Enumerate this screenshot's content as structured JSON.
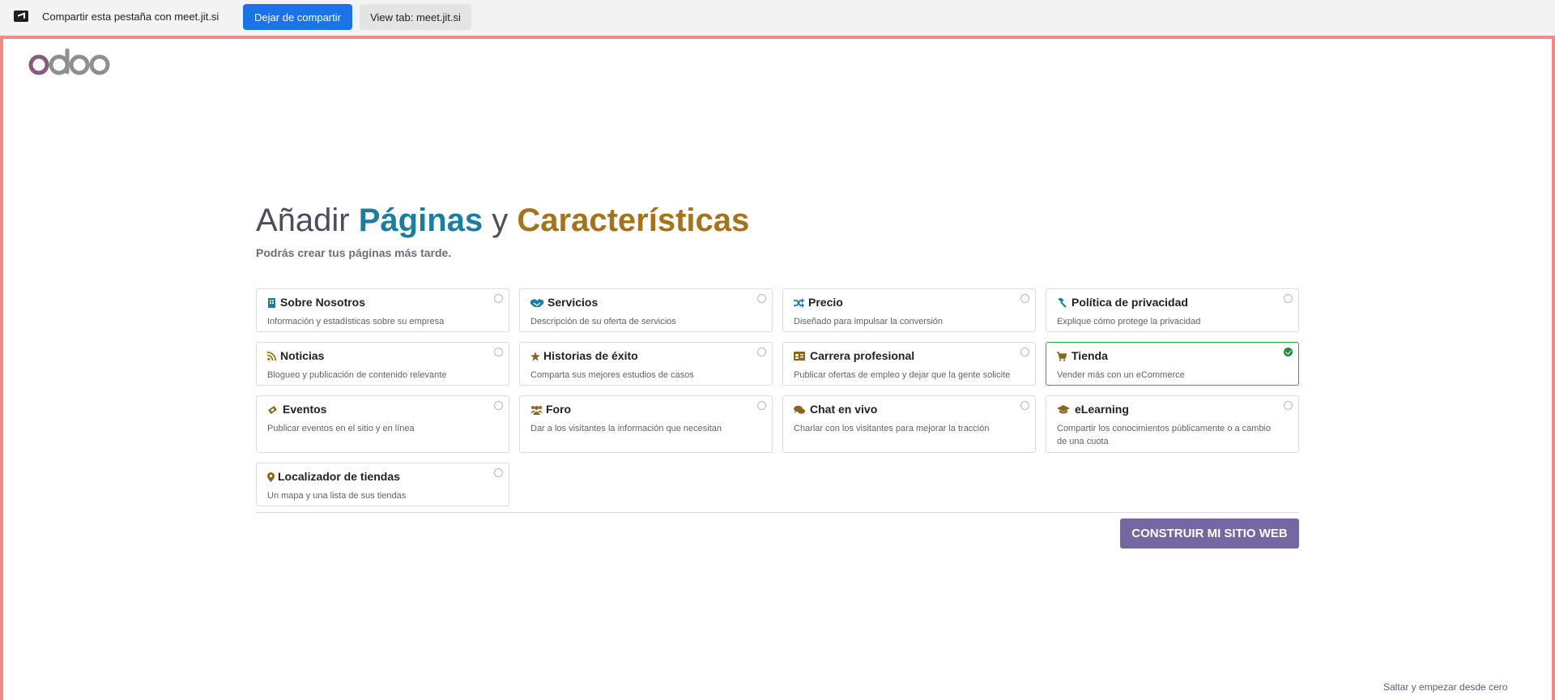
{
  "share_bar": {
    "text": "Compartir esta pestaña con meet.jit.si",
    "stop_label": "Dejar de compartir",
    "view_label": "View tab: meet.jit.si"
  },
  "brand": {
    "logo_text": "odoo",
    "accent": "#7567a1"
  },
  "header": {
    "title_prefix": "Añadir",
    "title_pages": "Páginas",
    "title_and": "y",
    "title_features": "Características",
    "subtitle": "Podrás crear tus páginas más tarde."
  },
  "cards": [
    {
      "title": "Sobre Nosotros",
      "desc": "Información y estadísticas sobre su empresa",
      "icon": "building-icon",
      "selected": false
    },
    {
      "title": "Servicios",
      "desc": "Descripción de su oferta de servicios",
      "icon": "handshake-icon",
      "selected": false
    },
    {
      "title": "Precio",
      "desc": "Diseñado para impulsar la conversión",
      "icon": "random-icon",
      "selected": false
    },
    {
      "title": "Política de privacidad",
      "desc": "Explique cómo protege la privacidad",
      "icon": "gavel-icon",
      "selected": false
    },
    {
      "title": "Noticias",
      "desc": "Blogueo y publicación de contenido relevante",
      "icon": "rss-icon",
      "selected": false
    },
    {
      "title": "Historias de éxito",
      "desc": "Comparta sus mejores estudios de casos",
      "icon": "star-icon",
      "selected": false
    },
    {
      "title": "Carrera profesional",
      "desc": "Publicar ofertas de empleo y dejar que la gente solicite",
      "icon": "id-card-icon",
      "selected": false
    },
    {
      "title": "Tienda",
      "desc": "Vender más con un eCommerce",
      "icon": "cart-icon",
      "selected": true
    },
    {
      "title": "Eventos",
      "desc": "Publicar eventos en el sitio y en línea",
      "icon": "ticket-icon",
      "selected": false
    },
    {
      "title": "Foro",
      "desc": "Dar a los visitantes la información que necesitan",
      "icon": "users-icon",
      "selected": false
    },
    {
      "title": "Chat en vivo",
      "desc": "Charlar con los visitantes para mejorar la tracción",
      "icon": "comments-icon",
      "selected": false
    },
    {
      "title": "eLearning",
      "desc": "Compartir los conocimientos públicamente o a cambio de una cuota",
      "icon": "graduation-cap-icon",
      "selected": false
    },
    {
      "title": "Localizador de tiendas",
      "desc": "Un mapa y una lista de sus tiendas",
      "icon": "map-marker-icon",
      "selected": false
    }
  ],
  "actions": {
    "build_label": "CONSTRUIR MI SITIO WEB",
    "skip_label": "Saltar y empezar desde cero"
  }
}
